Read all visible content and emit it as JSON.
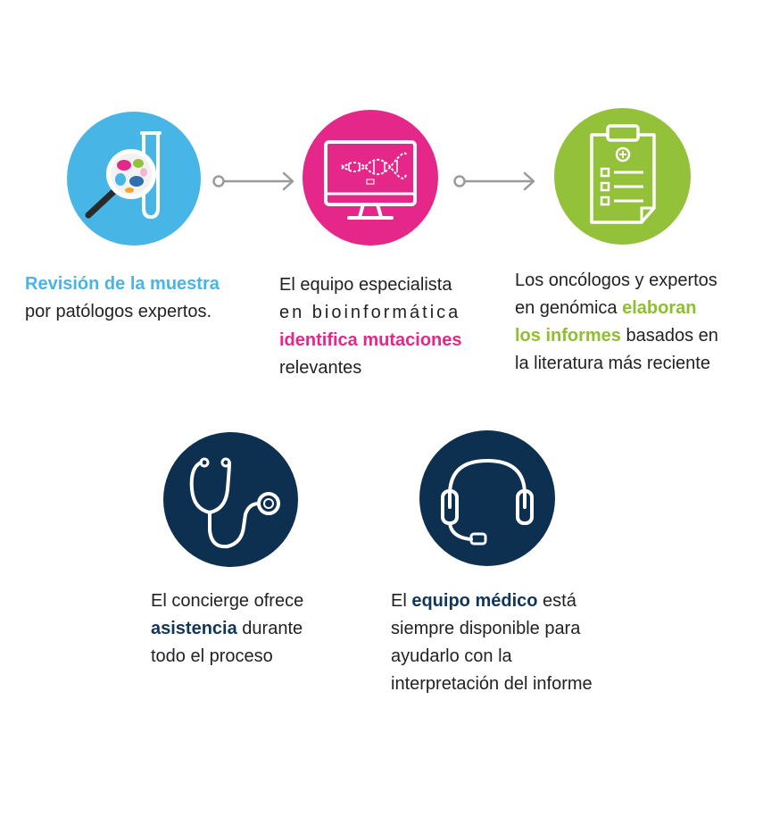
{
  "colors": {
    "blue": "#47b5e6",
    "pink": "#e6278a",
    "green": "#93c13a",
    "navy": "#0d3050",
    "arrow": "#9a9a9a"
  },
  "steps": [
    {
      "icon": "magnifier-test-tube-icon",
      "line1_highlight": "Revisión de la muestra",
      "line2": "por patólogos expertos."
    },
    {
      "icon": "computer-dna-icon",
      "line1": "El equipo especialista",
      "line2": "en bioinformática",
      "line3_highlight": "identifica mutaciones",
      "line4": "relevantes"
    },
    {
      "icon": "clipboard-report-icon",
      "line1": "Los oncólogos y expertos",
      "line2_pre": "en genómica ",
      "line2_highlight": "elaboran",
      "line3_highlight": "los informes",
      "line3_post": " basados en",
      "line4": "la literatura más reciente"
    }
  ],
  "support": [
    {
      "icon": "stethoscope-icon",
      "line1": "El concierge ofrece",
      "line2_highlight": "asistencia",
      "line2_post": " durante",
      "line3": "todo el proceso"
    },
    {
      "icon": "headset-icon",
      "line1_pre": "El ",
      "line1_highlight": "equipo médico",
      "line1_post": " está",
      "line2": "siempre disponible para",
      "line3": "ayudarlo con la",
      "line4": "interpretación del informe"
    }
  ]
}
